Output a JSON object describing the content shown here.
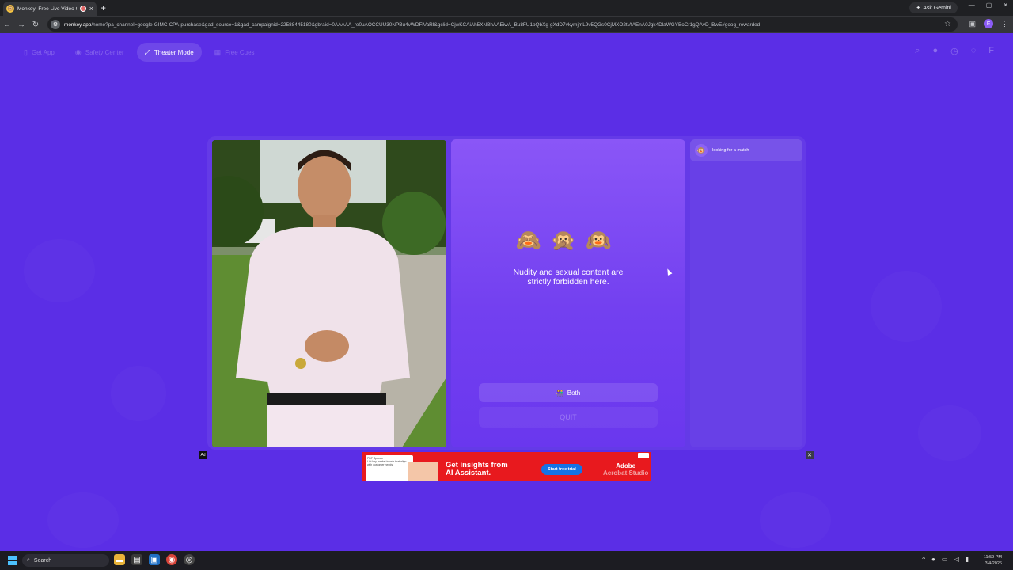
{
  "browser": {
    "tab_title": "Monkey: Free Live Video Ch",
    "new_tab": "+",
    "ask_gemini": "Ask Gemini",
    "url_domain": "monkey.app",
    "url_rest": "/home?pa_channel=google-GIMC-CPA-purchase&gad_source=1&gad_campaignid=22588445180&gbraid=0AAAAA_re0uAOCCUU30NPBu4vWDFlVaRI&gclid=CjwKCAiAh5XNBhAAEiwA_Bu8FU1pQbXg-gXdD7vkymjmL9v5QGs0CjMXO2tVfAEnA0Jgk4DlaWGYBoCr1gQAvD_BwE#goog_rewarded",
    "profile_initial": "F"
  },
  "topnav": {
    "items": [
      {
        "label": "Get App",
        "icon": "phone-icon"
      },
      {
        "label": "Safety Center",
        "icon": "shield-icon"
      },
      {
        "label": "Theater Mode",
        "icon": "expand-icon"
      },
      {
        "label": "Free Cues",
        "icon": "gift-icon"
      }
    ],
    "right_icons": [
      "search-icon",
      "coin-icon",
      "history-icon",
      "chat-icon"
    ],
    "user_initial": "F"
  },
  "center_panel": {
    "emojis": "🙈🙊🙉",
    "warning_line1": "Nudity and sexual content are",
    "warning_line2": "strictly forbidden here.",
    "both_button": "Both",
    "quit_button": "QUIT"
  },
  "side_panel": {
    "status": "looking for a match"
  },
  "ad": {
    "label": "Ad",
    "close": "✕",
    "thumb_title": "PDF Spaces",
    "thumb_text": "List key market trends that align with customer needs.",
    "headline_line1": "Get insights from",
    "headline_line2": "AI Assistant.",
    "cta": "Start free trial",
    "brand_line1": "Adobe",
    "brand_line2": "Acrobat Studio"
  },
  "taskbar": {
    "search": "Search",
    "time": "11:59 PM",
    "date": "3/4/2026"
  },
  "colors": {
    "page_bg": "#5b2ee6",
    "panel_purple": "#7a46f2",
    "ad_red": "#e8191e",
    "cta_blue": "#1473e6"
  }
}
